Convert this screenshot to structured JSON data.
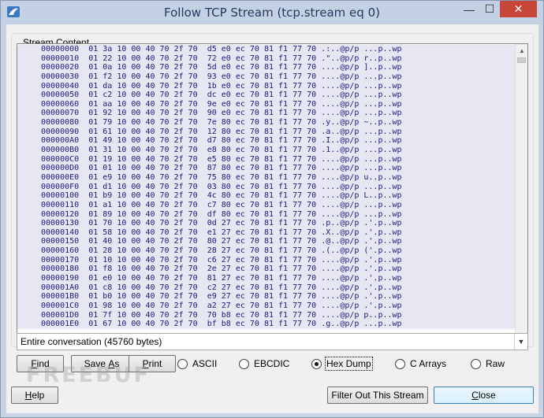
{
  "window": {
    "title": "Follow TCP Stream (tcp.stream eq 0)"
  },
  "stream": {
    "group_label": "Stream Content",
    "lines": [
      "00000000  01 3a 10 00 40 70 2f 70  d5 e0 ec 70 81 f1 77 70 .:..@p/p ...p..wp",
      "00000010  01 22 10 00 40 70 2f 70  72 e0 ec 70 81 f1 77 70 .\"..@p/p r..p..wp",
      "00000020  01 0a 10 00 40 70 2f 70  5d e0 ec 70 81 f1 77 70 ....@p/p ]..p..wp",
      "00000030  01 f2 10 00 40 70 2f 70  93 e0 ec 70 81 f1 77 70 ....@p/p ...p..wp",
      "00000040  01 da 10 00 40 70 2f 70  1b e0 ec 70 81 f1 77 70 ....@p/p ...p..wp",
      "00000050  01 c2 10 00 40 70 2f 70  dc e0 ec 70 81 f1 77 70 ....@p/p ...p..wp",
      "00000060  01 aa 10 00 40 70 2f 70  9e e0 ec 70 81 f1 77 70 ....@p/p ...p..wp",
      "00000070  01 92 10 00 40 70 2f 70  90 e0 ec 70 81 f1 77 70 ....@p/p ...p..wp",
      "00000080  01 79 10 00 40 70 2f 70  7e 80 ec 70 81 f1 77 70 .y..@p/p ~..p..wp",
      "00000090  01 61 10 00 40 70 2f 70  12 80 ec 70 81 f1 77 70 .a..@p/p ...p..wp",
      "000000A0  01 49 10 00 40 70 2f 70  d7 80 ec 70 81 f1 77 70 .I..@p/p ...p..wp",
      "000000B0  01 31 10 00 40 70 2f 70  e8 80 ec 70 81 f1 77 70 .1..@p/p ...p..wp",
      "000000C0  01 19 10 00 40 70 2f 70  e5 80 ec 70 81 f1 77 70 ....@p/p ...p..wp",
      "000000D0  01 01 10 00 40 70 2f 70  87 80 ec 70 81 f1 77 70 ....@p/p ...p..wp",
      "000000E0  01 e9 10 00 40 70 2f 70  75 80 ec 70 81 f1 77 70 ....@p/p u..p..wp",
      "000000F0  01 d1 10 00 40 70 2f 70  03 80 ec 70 81 f1 77 70 ....@p/p ...p..wp",
      "00000100  01 b9 10 00 40 70 2f 70  4c 80 ec 70 81 f1 77 70 ....@p/p L..p..wp",
      "00000110  01 a1 10 00 40 70 2f 70  c7 80 ec 70 81 f1 77 70 ....@p/p ...p..wp",
      "00000120  01 89 10 00 40 70 2f 70  df 80 ec 70 81 f1 77 70 ....@p/p ...p..wp",
      "00000130  01 70 10 00 40 70 2f 70  0d 27 ec 70 81 f1 77 70 .p..@p/p .'.p..wp",
      "00000140  01 58 10 00 40 70 2f 70  e1 27 ec 70 81 f1 77 70 .X..@p/p .'.p..wp",
      "00000150  01 40 10 00 40 70 2f 70  80 27 ec 70 81 f1 77 70 .@..@p/p .'.p..wp",
      "00000160  01 28 10 00 40 70 2f 70  28 27 ec 70 81 f1 77 70 .(..@p/p ('.p..wp",
      "00000170  01 10 10 00 40 70 2f 70  c6 27 ec 70 81 f1 77 70 ....@p/p .'.p..wp",
      "00000180  01 f8 10 00 40 70 2f 70  2e 27 ec 70 81 f1 77 70 ....@p/p .'.p..wp",
      "00000190  01 e0 10 00 40 70 2f 70  81 27 ec 70 81 f1 77 70 ....@p/p .'.p..wp",
      "000001A0  01 c8 10 00 40 70 2f 70  c2 27 ec 70 81 f1 77 70 ....@p/p .'.p..wp",
      "000001B0  01 b0 10 00 40 70 2f 70  e9 27 ec 70 81 f1 77 70 ....@p/p .'.p..wp",
      "000001C0  01 98 10 00 40 70 2f 70  a2 27 ec 70 81 f1 77 70 ....@p/p .'.p..wp",
      "000001D0  01 7f 10 00 40 70 2f 70  70 b8 ec 70 81 f1 77 70 ....@p/p p..p..wp",
      "000001E0  01 67 10 00 40 70 2f 70  bf b8 ec 70 81 f1 77 70 .g..@p/p ...p..wp"
    ]
  },
  "conversation_select": {
    "value": "Entire conversation (45760 bytes)"
  },
  "buttons": {
    "find": {
      "mnemonic": "F",
      "rest": "ind"
    },
    "save_as": {
      "before": "Save ",
      "mnemonic": "A",
      "after": "s"
    },
    "print": {
      "mnemonic": "P",
      "rest": "rint"
    },
    "help": {
      "mnemonic": "H",
      "rest": "elp"
    },
    "filter_out": "Filter Out This Stream",
    "close": {
      "mnemonic": "C",
      "rest": "lose"
    }
  },
  "display_modes": {
    "selected": "Hex Dump",
    "options": [
      "ASCII",
      "EBCDIC",
      "Hex Dump",
      "C Arrays",
      "Raw"
    ]
  },
  "watermark": "FREEBUF"
}
